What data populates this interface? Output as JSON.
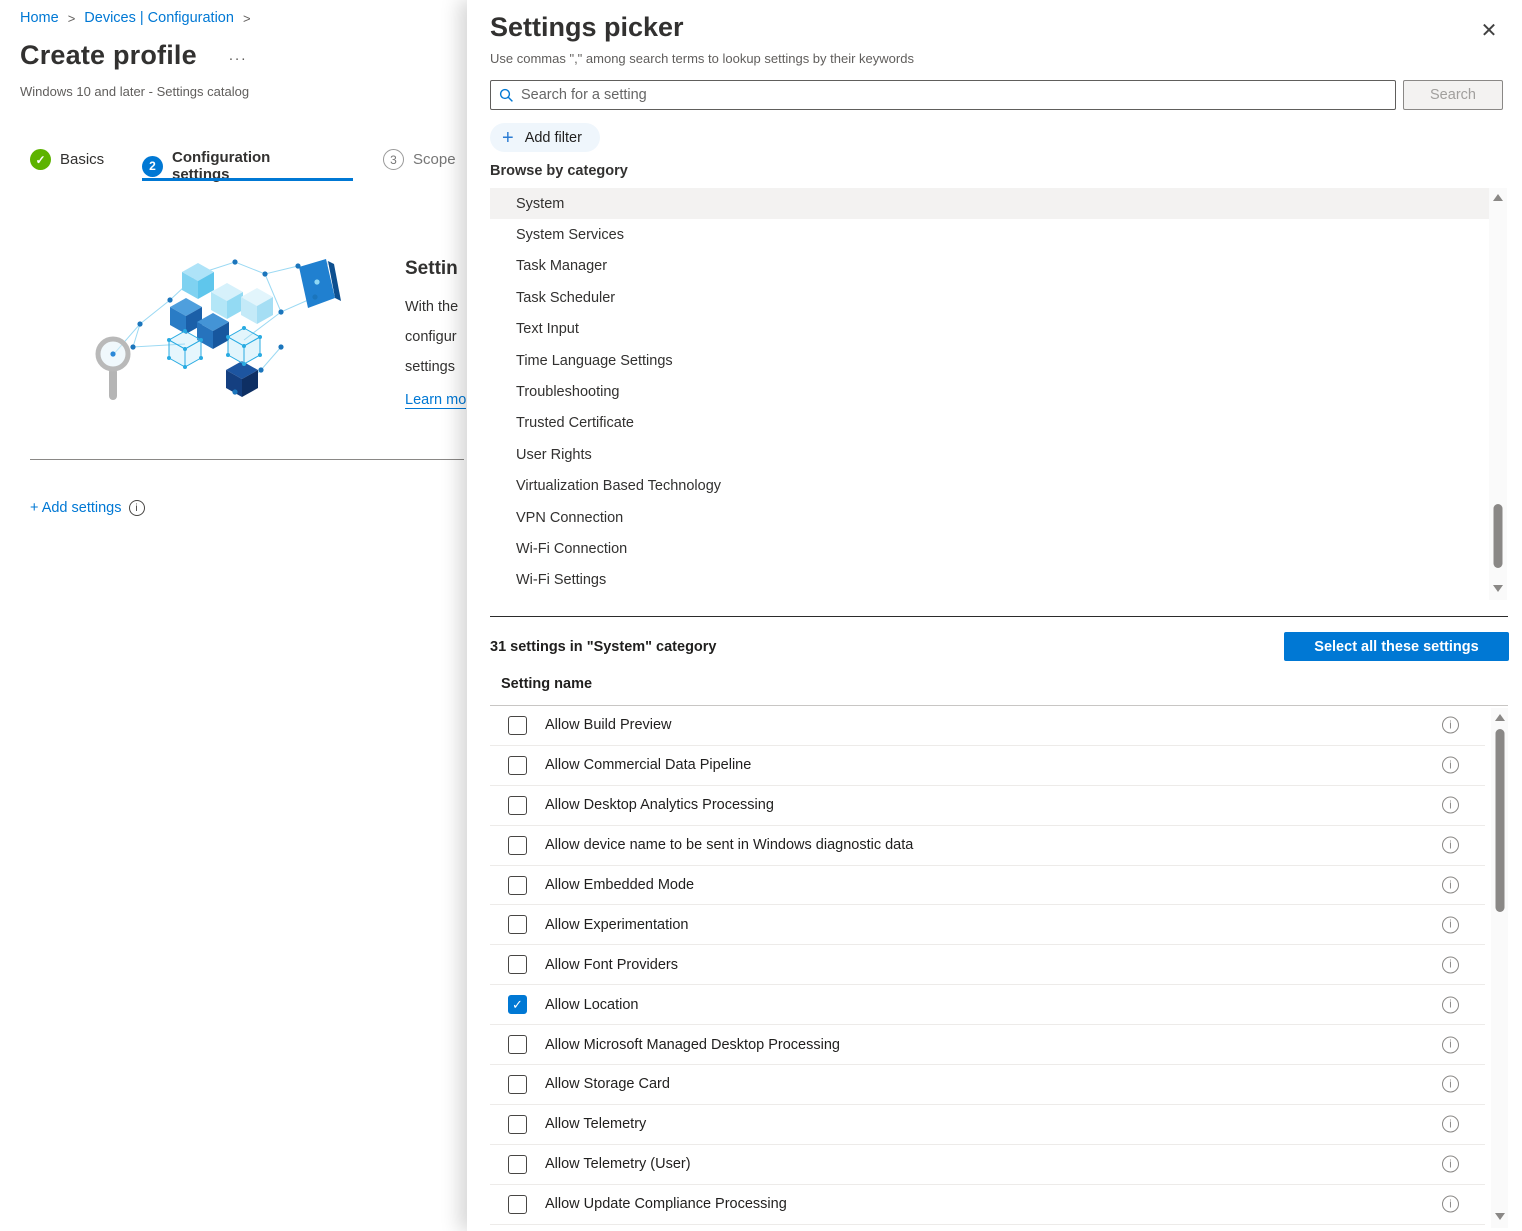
{
  "page": {
    "breadcrumb": {
      "items": [
        "Home",
        "Devices | Configuration"
      ]
    },
    "title": "Create profile",
    "title_more": "...",
    "subtitle": "Windows 10 and later - Settings catalog",
    "tabs": [
      {
        "label": "Basics"
      },
      {
        "label": "Configuration settings",
        "number": "2"
      },
      {
        "label": "Scope",
        "number": "3"
      }
    ],
    "intro": {
      "heading_fragment": "Settin",
      "body_fragments": [
        "With the",
        "configur",
        "settings"
      ],
      "link_fragment": "Learn mo"
    },
    "add_settings_label": "+ Add settings"
  },
  "panel": {
    "title": "Settings picker",
    "subtitle": "Use commas \",\" among search terms to lookup settings by their keywords",
    "search_placeholder": "Search for a setting",
    "search_button": "Search",
    "add_filter_label": "Add filter",
    "browse_heading": "Browse by category",
    "selected_category": "System",
    "categories": [
      {
        "label": "System",
        "selected": true
      },
      {
        "label": "System Services"
      },
      {
        "label": "Task Manager"
      },
      {
        "label": "Task Scheduler"
      },
      {
        "label": "Text Input"
      },
      {
        "label": "Time Language Settings"
      },
      {
        "label": "Troubleshooting"
      },
      {
        "label": "Trusted Certificate"
      },
      {
        "label": "User Rights"
      },
      {
        "label": "Virtualization Based Technology"
      },
      {
        "label": "VPN Connection"
      },
      {
        "label": "Wi-Fi Connection"
      },
      {
        "label": "Wi-Fi Settings"
      }
    ],
    "results_summary": "31 settings in \"System\" category",
    "select_all_button": "Select all these settings",
    "column_header": "Setting name",
    "settings": [
      {
        "label": "Allow Build Preview",
        "checked": false
      },
      {
        "label": "Allow Commercial Data Pipeline",
        "checked": false
      },
      {
        "label": "Allow Desktop Analytics Processing",
        "checked": false
      },
      {
        "label": "Allow device name to be sent in Windows diagnostic data",
        "checked": false
      },
      {
        "label": "Allow Embedded Mode",
        "checked": false
      },
      {
        "label": "Allow Experimentation",
        "checked": false
      },
      {
        "label": "Allow Font Providers",
        "checked": false
      },
      {
        "label": "Allow Location",
        "checked": true
      },
      {
        "label": "Allow Microsoft Managed Desktop Processing",
        "checked": false
      },
      {
        "label": "Allow Storage Card",
        "checked": false
      },
      {
        "label": "Allow Telemetry",
        "checked": false
      },
      {
        "label": "Allow Telemetry (User)",
        "checked": false
      },
      {
        "label": "Allow Update Compliance Processing",
        "checked": false
      }
    ]
  },
  "colors": {
    "accent": "#0078d4",
    "success": "#5db300",
    "selected_row_bg": "#f3f2f1"
  }
}
